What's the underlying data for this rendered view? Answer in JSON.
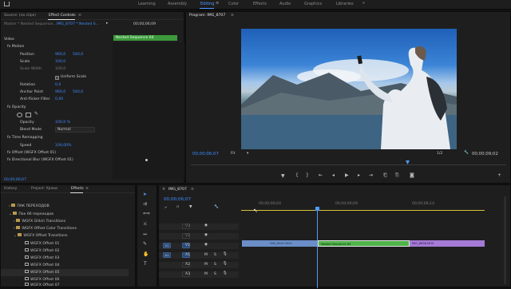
{
  "workspaces": [
    {
      "label": "Learning"
    },
    {
      "label": "Assembly"
    },
    {
      "label": "Editing"
    },
    {
      "label": "Color"
    },
    {
      "label": "Effects"
    },
    {
      "label": "Audio"
    },
    {
      "label": "Graphics"
    },
    {
      "label": "Libraries"
    }
  ],
  "source_panel": {
    "tab_source": "Source: (no clips)",
    "tab_effect_controls": "Effect Controls",
    "master": "Master * Nested Sequence…",
    "clip": "IMG_8707 * Nested S…",
    "tc": "00;00;06;09",
    "nested_label": "Nested Sequence 64",
    "section_video": "Video",
    "footer_tc": "00;00;06;07",
    "rows": [
      {
        "label": "fx  Motion",
        "v1": "",
        "v2": ""
      },
      {
        "label": "Position",
        "v1": "960,0",
        "v2": "540,0"
      },
      {
        "label": "Scale",
        "v1": "100,0",
        "v2": ""
      },
      {
        "label": "Scale Width",
        "v1": "100,0",
        "v2": ""
      },
      {
        "label": "Uniform Scale",
        "v1": "",
        "v2": ""
      },
      {
        "label": "Rotation",
        "v1": "0,0",
        "v2": ""
      },
      {
        "label": "Anchor Point",
        "v1": "960,0",
        "v2": "540,0"
      },
      {
        "label": "Anti-flicker Filter",
        "v1": "0,00",
        "v2": ""
      },
      {
        "label": "fx  Opacity",
        "v1": "",
        "v2": ""
      },
      {
        "label": "Opacity",
        "v1": "100,0 %",
        "v2": ""
      },
      {
        "label": "Blend Mode",
        "v1": "Normal",
        "v2": ""
      },
      {
        "label": "fx  Time Remapping",
        "v1": "",
        "v2": ""
      },
      {
        "label": "Speed",
        "v1": "100,00%",
        "v2": ""
      },
      {
        "label": "fx  Offset (WGFX Offset 01)",
        "v1": "",
        "v2": ""
      },
      {
        "label": "fx  Directional Blur (WGFX Offset 01)",
        "v1": "",
        "v2": ""
      }
    ]
  },
  "program": {
    "title": "Program: IMG_8707",
    "tc_left": "00;00;06;07",
    "fit": "Fit",
    "ratio": "1/2",
    "tc_right": "00;00;09;02"
  },
  "project": {
    "tab_history": "History",
    "tab_project": "Project: Уроки",
    "tab_effects": "Effects",
    "items": [
      {
        "label": "ПАК ПЕРЕХОДОВ"
      },
      {
        "label": "Пак 66 переходов"
      },
      {
        "label": "WGFX Glitch Transitions"
      },
      {
        "label": "WGFX Offset Color Transitions"
      },
      {
        "label": "WGFX Offset Transitions"
      },
      {
        "label": "WGFX Offset 01"
      },
      {
        "label": "WGFX Offset 02"
      },
      {
        "label": "WGFX Offset 03"
      },
      {
        "label": "WGFX Offset 04"
      },
      {
        "label": "WGFX Offset 05"
      },
      {
        "label": "WGFX Offset 06"
      },
      {
        "label": "WGFX Offset 07"
      }
    ]
  },
  "timeline": {
    "tab": "IMG_8707",
    "tc": "00;00;06;07",
    "ruler": [
      "00;00;06;04",
      "00;00;06;09",
      "00;00;06;14"
    ],
    "clips": [
      {
        "label": "IMG_8447.MOV"
      },
      {
        "label": "Nested Sequence 64"
      },
      {
        "label": "IMG_8658.MOV"
      }
    ],
    "tracks": [
      "V3",
      "V2",
      "V1",
      "A1",
      "A2",
      "A3"
    ]
  },
  "colors": {
    "accent": "#4e9bff",
    "nested_clip": "#4fb34a",
    "clip_blue": "#6b8ec8",
    "clip_purple": "#a47ad6"
  }
}
